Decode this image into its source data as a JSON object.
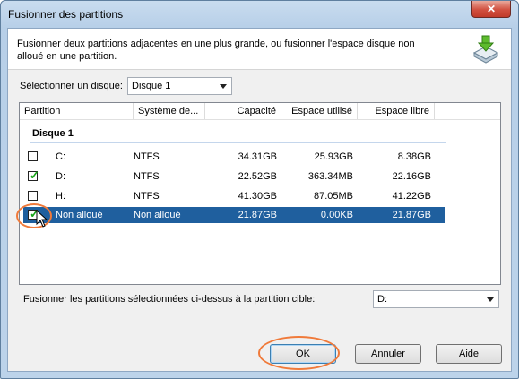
{
  "window": {
    "title": "Fusionner des partitions",
    "close_symbol": "✕"
  },
  "description": "Fusionner deux partitions adjacentes en une plus grande, ou fusionner l'espace disque non alloué en une partition.",
  "disk_select": {
    "label": "Sélectionner un disque:",
    "value": "Disque 1"
  },
  "table": {
    "columns": [
      "Partition",
      "Système de...",
      "Capacité",
      "Espace utilisé",
      "Espace libre"
    ],
    "group": "Disque 1",
    "rows": [
      {
        "checked": false,
        "partition": "C:",
        "fs": "NTFS",
        "capacity": "34.31GB",
        "used": "25.93GB",
        "free": "8.38GB"
      },
      {
        "checked": true,
        "partition": "D:",
        "fs": "NTFS",
        "capacity": "22.52GB",
        "used": "363.34MB",
        "free": "22.16GB"
      },
      {
        "checked": false,
        "partition": "H:",
        "fs": "NTFS",
        "capacity": "41.30GB",
        "used": "87.05MB",
        "free": "41.22GB"
      },
      {
        "checked": true,
        "partition": "Non alloué",
        "fs": "Non alloué",
        "capacity": "21.87GB",
        "used": "0.00KB",
        "free": "21.87GB"
      }
    ]
  },
  "target": {
    "label": "Fusionner les partitions sélectionnées ci-dessus à la partition cible:",
    "value": "D:"
  },
  "buttons": {
    "ok": "OK",
    "cancel": "Annuler",
    "help": "Aide"
  },
  "check_symbol": "✓",
  "colors": {
    "selection": "#1f5f9e",
    "highlight_ring": "#f07a3a",
    "check": "#1aa51a"
  }
}
